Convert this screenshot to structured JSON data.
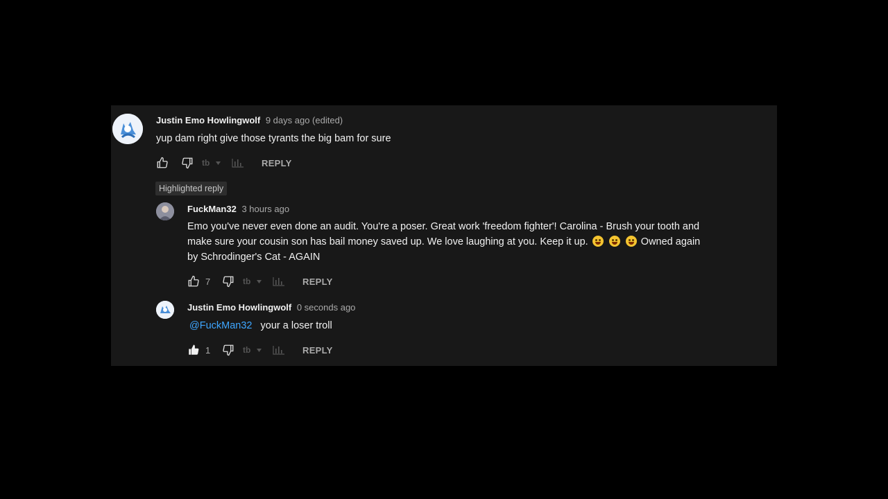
{
  "comments": [
    {
      "author": "Justin Emo Howlingwolf",
      "time": "9 days ago (edited)",
      "text": "yup dam right give those tyrants the  big bam for sure",
      "likes": "",
      "reply_label": "REPLY"
    }
  ],
  "highlighted_badge": "Highlighted reply",
  "replies": [
    {
      "author": "FuckMan32",
      "time": "3 hours ago",
      "text_line1": "Emo you've never even done an audit. You're a poser. Great work 'freedom fighter'! Carolina - Brush your tooth and",
      "text_line2": "make sure your cousin son has bail money saved up. We love laughing at you. Keep it up.",
      "text_line2_tail": "Owned again",
      "text_line3": "by Schrodinger's Cat - AGAIN",
      "likes": "7",
      "reply_label": "REPLY"
    },
    {
      "author": "Justin Emo Howlingwolf",
      "time": "0 seconds ago",
      "mention": "@FuckMan32",
      "text": "your a loser troll",
      "likes": "1",
      "reply_label": "REPLY"
    }
  ],
  "icons": {
    "like": "thumbs-up-icon",
    "dislike": "thumbs-down-icon",
    "translate": "translate-icon",
    "stats": "bar-chart-icon"
  },
  "colors": {
    "panel_bg": "#181818",
    "mention": "#3ea6ff",
    "meta_text": "#aaaaaa"
  }
}
